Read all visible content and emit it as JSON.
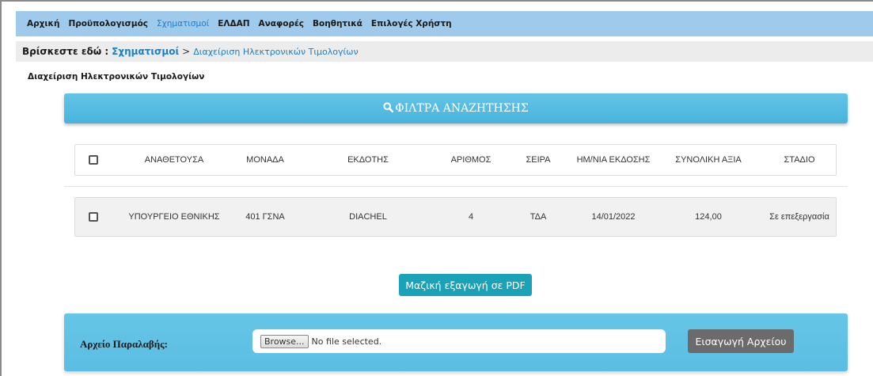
{
  "nav": {
    "items": [
      "Αρχική",
      "Προϋπολογισμός",
      "Σχηματισμοί",
      "ΕΛΔΑΠ",
      "Αναφορές",
      "Βοηθητικά",
      "Επιλογές Χρήστη"
    ],
    "active": "Σχηματισμοί"
  },
  "breadcrumb": {
    "label": "Βρίσκεστε εδώ :",
    "link": "Σχηματισμοί",
    "separator": ">",
    "current": "Διαχείριση Ηλεκτρονικών Τιμολογίων"
  },
  "page_title": "Διαχείριση Ηλεκτρονικών Τιμολογίων",
  "filters": {
    "icon": "search-icon",
    "label": "ΦΙΛΤΡΑ ΑΝΑΖΗΤΗΣΗΣ"
  },
  "table": {
    "columns": [
      "ΑΝΑΘΕΤΟΥΣΑ",
      "ΜΟΝΑΔΑ",
      "ΕΚΔΟΤΗΣ",
      "ΑΡΙΘΜΟΣ",
      "ΣΕΙΡΑ",
      "ΗΜ/ΝΙΑ ΕΚΔΟΣΗΣ",
      "ΣΥΝΟΛΙΚΗ ΑΞΙΑ",
      "ΣΤΑΔΙΟ"
    ],
    "rows": [
      [
        "ΥΠΟΥΡΓΕΙΟ ΕΘΝΙΚΗΣ",
        "401 ΓΣΝΑ",
        "DIACHEL",
        "4",
        "ΤΔΑ",
        "14/01/2022",
        "124,00",
        "Σε επεξεργασία"
      ]
    ]
  },
  "export_button": "Μαζική εξαγωγή σε PDF",
  "upload": {
    "label": "Αρχείο Παραλαβής:",
    "browse": "Browse...",
    "status": "No file selected.",
    "import_button": "Εισαγωγή Αρχείου"
  },
  "colors": {
    "nav_bg": "#9fcaec",
    "accent": "#1c7fc4",
    "filters_bg": "#49b3dc",
    "export_bg": "#1aa3b8",
    "import_bg": "#6b6b6b"
  }
}
